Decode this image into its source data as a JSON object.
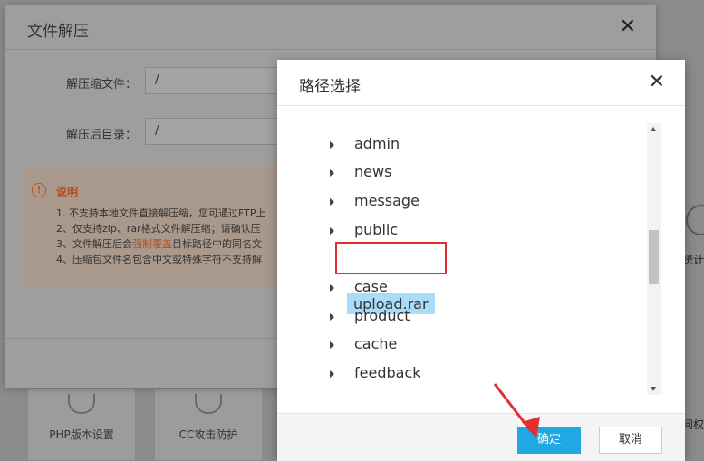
{
  "background": {
    "cards": [
      {
        "label": "PHP版本设置"
      },
      {
        "label": "CC攻击防护"
      }
    ],
    "right_text": "统计",
    "right_bottom_text": "问权"
  },
  "extract_dialog": {
    "title": "文件解压",
    "close_glyph": "✕",
    "source_label": "解压缩文件：",
    "source_value": "/",
    "target_label": "解压后目录：",
    "target_value": "/",
    "notice": {
      "icon_glyph": "!",
      "title": "说明",
      "items": [
        "1. 不支持本地文件直接解压缩，您可通过FTP上",
        "2、仅支持zip、rar格式文件解压缩；请确认压",
        "3、文件解压后会",
        "4、压缩包文件名包含中文或特殊字符不支持解"
      ],
      "item3_strong": "强制覆盖",
      "item3_tail": "目标路径中的同名文"
    }
  },
  "path_dialog": {
    "title": "路径选择",
    "close_glyph": "✕",
    "items": [
      {
        "name": "admin",
        "has_children": true
      },
      {
        "name": "news",
        "has_children": true
      },
      {
        "name": "message",
        "has_children": true
      },
      {
        "name": "public",
        "has_children": true
      },
      {
        "name": "upload.rar",
        "has_children": false,
        "selected": true
      },
      {
        "name": "case",
        "has_children": true
      },
      {
        "name": "product",
        "has_children": true
      },
      {
        "name": "cache",
        "has_children": true
      },
      {
        "name": "feedback",
        "has_children": true
      }
    ],
    "ok_label": "确定",
    "cancel_label": "取消"
  },
  "colors": {
    "accent": "#20a8e4",
    "selected_bg": "#a8dcf7",
    "annotation_red": "#e0312f",
    "warning_orange": "#b34f1e"
  }
}
